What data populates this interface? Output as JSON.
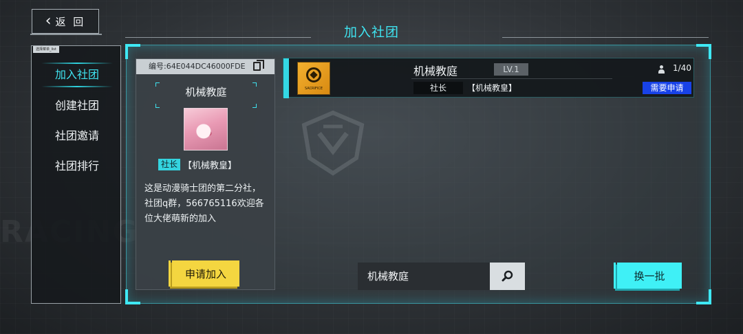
{
  "header": {
    "back_label": "返 回",
    "title": "加入社团"
  },
  "menu": {
    "tag": "选择菜单_list",
    "items": [
      {
        "label": "加入社团",
        "active": true
      },
      {
        "label": "创建社团",
        "active": false
      },
      {
        "label": "社团邀请",
        "active": false
      },
      {
        "label": "社团排行",
        "active": false
      }
    ]
  },
  "detail": {
    "code": "编号:64E044DC46000FDE",
    "club_name": "机械教庭",
    "leader_tag": "社长",
    "leader_name": "【机械教皇】",
    "description": "这是动漫骑士团的第二分社，\n社团q群，566765116欢迎各\n位大佬萌新的加入",
    "apply_label": "申请加入"
  },
  "list": {
    "items": [
      {
        "name": "机械教庭",
        "level": "LV.1",
        "role": "社长",
        "leader": "【机械教皇】",
        "members": "1/40",
        "status": "需要申请",
        "badge_text": "SACRIFICE"
      }
    ]
  },
  "search": {
    "value": "机械教庭",
    "refresh_label": "换一批"
  },
  "colors": {
    "accent": "#3fe3f0",
    "apply_yellow": "#f4d640",
    "status_blue": "#1842e8"
  },
  "background_text": "RACING"
}
